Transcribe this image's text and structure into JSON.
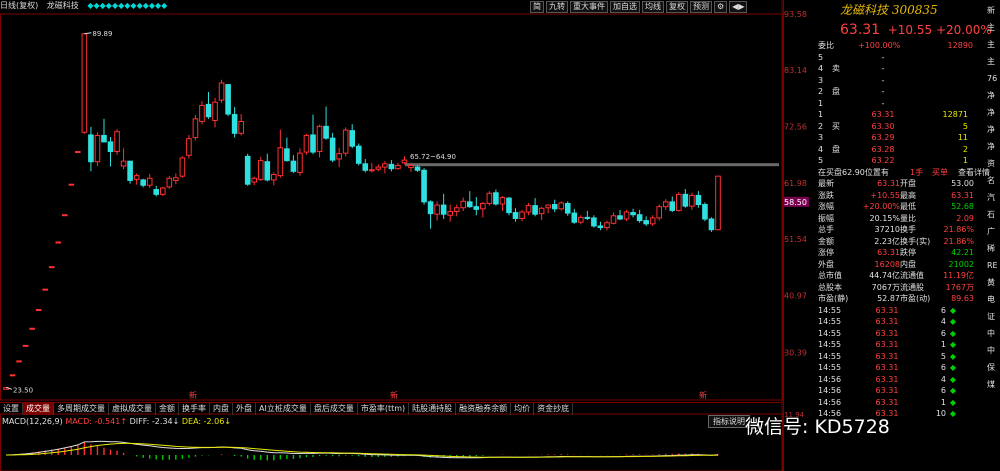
{
  "window": {
    "title": "日线(复权)",
    "stock_name": "龙磁科技"
  },
  "toolbar": [
    "简",
    "九转",
    "重大事件",
    "加自选",
    "均线",
    "复权",
    "预测",
    "⚙",
    "◀▶"
  ],
  "chart_data": {
    "type": "candlestick",
    "y_ticks": [
      93.58,
      83.14,
      72.56,
      61.98,
      51.54,
      40.97,
      30.39
    ],
    "current_price_tag": 58.5,
    "annotations": {
      "high": "89.89",
      "low": "23.50",
      "range": "65.72~64.90"
    },
    "candles": [
      [
        23.5,
        23.8,
        23.5,
        23.8
      ],
      [
        26.2,
        26.2,
        26.2,
        26.2
      ],
      [
        28.8,
        28.8,
        28.8,
        28.8
      ],
      [
        31.7,
        31.7,
        31.7,
        31.7
      ],
      [
        34.9,
        34.9,
        34.9,
        34.9
      ],
      [
        38.4,
        38.4,
        38.4,
        38.4
      ],
      [
        42.2,
        42.2,
        42.2,
        42.2
      ],
      [
        46.4,
        46.4,
        46.4,
        46.4
      ],
      [
        51.0,
        51.0,
        51.0,
        51.0
      ],
      [
        56.1,
        56.1,
        56.1,
        56.1
      ],
      [
        61.8,
        61.8,
        61.8,
        61.8
      ],
      [
        67.9,
        67.9,
        67.9,
        67.9
      ],
      [
        71.5,
        89.9,
        71.2,
        89.9
      ],
      [
        71.0,
        72.5,
        64.2,
        66.0
      ],
      [
        66.0,
        71.5,
        65.2,
        70.9
      ],
      [
        70.9,
        74.0,
        69.6,
        69.7
      ],
      [
        69.7,
        70.6,
        65.1,
        67.9
      ],
      [
        67.9,
        72.1,
        67.3,
        71.6
      ],
      [
        65.2,
        68.5,
        64.6,
        66.1
      ],
      [
        66.1,
        66.1,
        61.9,
        62.5
      ],
      [
        62.7,
        63.8,
        61.7,
        63.4
      ],
      [
        62.6,
        62.8,
        61.2,
        61.6
      ],
      [
        61.6,
        63.7,
        61.1,
        62.9
      ],
      [
        60.8,
        61.5,
        59.5,
        59.9
      ],
      [
        59.9,
        61.3,
        59.6,
        61.1
      ],
      [
        61.3,
        63.3,
        60.9,
        62.9
      ],
      [
        62.5,
        63.8,
        61.8,
        63.0
      ],
      [
        63.3,
        67.0,
        63.0,
        66.7
      ],
      [
        67.2,
        71.0,
        66.6,
        70.3
      ],
      [
        70.5,
        74.7,
        70.0,
        74.0
      ],
      [
        73.5,
        77.3,
        73.0,
        76.5
      ],
      [
        76.7,
        79.0,
        74.0,
        74.4
      ],
      [
        73.7,
        77.9,
        72.4,
        77.1
      ],
      [
        77.5,
        81.3,
        77.0,
        80.7
      ],
      [
        80.4,
        80.5,
        74.5,
        74.9
      ],
      [
        74.8,
        76.2,
        70.5,
        71.3
      ],
      [
        71.3,
        74.9,
        70.9,
        73.5
      ],
      [
        67.0,
        67.5,
        61.5,
        61.8
      ],
      [
        62.2,
        63.2,
        61.6,
        62.9
      ],
      [
        62.7,
        66.9,
        62.4,
        66.2
      ],
      [
        66.0,
        67.5,
        62.3,
        62.6
      ],
      [
        62.6,
        64.0,
        61.6,
        63.6
      ],
      [
        63.4,
        72.0,
        63.0,
        68.6
      ],
      [
        68.4,
        70.5,
        66.0,
        66.2
      ],
      [
        66.1,
        67.2,
        63.9,
        64.2
      ],
      [
        64.0,
        68.5,
        63.4,
        67.6
      ],
      [
        67.8,
        71.2,
        67.3,
        70.9
      ],
      [
        71.0,
        74.8,
        67.4,
        67.8
      ],
      [
        67.9,
        72.9,
        66.8,
        72.6
      ],
      [
        72.6,
        76.3,
        70.1,
        70.4
      ],
      [
        70.4,
        71.4,
        65.9,
        66.3
      ],
      [
        66.5,
        68.6,
        65.0,
        67.5
      ],
      [
        67.6,
        72.4,
        67.0,
        71.9
      ],
      [
        71.8,
        73.0,
        68.5,
        68.9
      ],
      [
        68.9,
        69.4,
        65.3,
        65.7
      ],
      [
        65.6,
        66.5,
        64.0,
        64.4
      ],
      [
        64.5,
        65.8,
        64.0,
        64.5
      ],
      [
        64.6,
        65.5,
        64.2,
        65.0
      ],
      [
        65.0,
        66.1,
        63.8,
        65.6
      ],
      [
        65.5,
        66.3,
        64.2,
        64.7
      ],
      [
        64.7,
        65.8,
        64.5,
        65.3
      ],
      [
        65.8,
        67.0,
        65.5,
        66.3
      ],
      [
        64.9,
        65.7,
        64.1,
        65.3
      ],
      [
        65.0,
        65.3,
        64.1,
        64.4
      ],
      [
        64.4,
        64.8,
        58.0,
        58.5
      ],
      [
        58.5,
        58.8,
        53.5,
        56.3
      ],
      [
        56.2,
        58.6,
        55.0,
        57.9
      ],
      [
        57.9,
        60.0,
        55.3,
        56.2
      ],
      [
        56.0,
        58.0,
        54.8,
        56.7
      ],
      [
        56.7,
        58.0,
        55.8,
        57.4
      ],
      [
        57.4,
        59.3,
        56.8,
        58.6
      ],
      [
        58.5,
        60.5,
        57.4,
        57.6
      ],
      [
        57.6,
        59.4,
        56.0,
        57.1
      ],
      [
        57.2,
        58.5,
        55.6,
        58.2
      ],
      [
        58.2,
        60.5,
        57.8,
        60.1
      ],
      [
        60.2,
        60.8,
        57.8,
        58.1
      ],
      [
        58.1,
        59.6,
        56.8,
        59.3
      ],
      [
        59.2,
        59.4,
        56.0,
        56.5
      ],
      [
        56.5,
        57.3,
        54.8,
        55.4
      ],
      [
        55.4,
        57.0,
        54.9,
        56.6
      ],
      [
        56.6,
        58.3,
        56.0,
        57.8
      ],
      [
        57.8,
        59.2,
        55.8,
        56.2
      ],
      [
        56.3,
        57.6,
        55.1,
        57.3
      ],
      [
        57.4,
        58.0,
        56.4,
        57.9
      ],
      [
        58.0,
        58.9,
        56.6,
        57.2
      ],
      [
        57.2,
        58.6,
        56.9,
        58.3
      ],
      [
        58.2,
        58.6,
        55.9,
        56.4
      ],
      [
        56.4,
        57.2,
        54.4,
        54.7
      ],
      [
        54.7,
        56.0,
        54.3,
        55.6
      ],
      [
        55.6,
        56.8,
        55.1,
        55.4
      ],
      [
        55.5,
        56.0,
        53.7,
        54.0
      ],
      [
        54.0,
        54.8,
        53.2,
        53.7
      ],
      [
        53.7,
        55.0,
        53.2,
        54.6
      ],
      [
        54.5,
        56.5,
        54.3,
        55.9
      ],
      [
        55.9,
        57.0,
        55.1,
        55.3
      ],
      [
        55.3,
        57.0,
        54.9,
        56.6
      ],
      [
        56.5,
        57.2,
        55.6,
        56.1
      ],
      [
        56.1,
        57.0,
        54.6,
        55.0
      ],
      [
        55.0,
        55.8,
        54.0,
        54.4
      ],
      [
        54.4,
        56.0,
        54.0,
        55.5
      ],
      [
        55.5,
        58.0,
        55.0,
        57.6
      ],
      [
        57.6,
        59.0,
        57.0,
        58.5
      ],
      [
        58.5,
        59.5,
        56.6,
        56.9
      ],
      [
        56.9,
        60.3,
        56.7,
        59.9
      ],
      [
        59.9,
        60.9,
        57.4,
        57.7
      ],
      [
        57.7,
        60.2,
        57.0,
        59.7
      ],
      [
        59.7,
        60.5,
        57.4,
        58.0
      ],
      [
        58.0,
        58.4,
        54.9,
        55.3
      ],
      [
        55.3,
        55.6,
        52.9,
        53.3
      ],
      [
        53.3,
        63.3,
        53.3,
        63.3
      ]
    ],
    "macd": {
      "label": "MACD(12,26,9)",
      "macd": "MACD: -0.541↑",
      "diff": "DIFF: -2.34↓",
      "dea": "DEA: -2.06↓",
      "axis_top": "11.94"
    }
  },
  "markers": {
    "a": "新",
    "b": "新",
    "c": "新",
    "d": "新"
  },
  "tabs": [
    "设置",
    "成交量",
    "多周期成交量",
    "虚拟成交量",
    "金额",
    "换手率",
    "内盘",
    "外盘",
    "AI立桩成交量",
    "盘后成交量",
    "市盈率(ttm)",
    "陆股通持股",
    "融资融券余额",
    "均价",
    "资金抄底"
  ],
  "active_tab": "成交量",
  "index_button": "指标说明",
  "quote": {
    "name": "龙磁科技",
    "code": "300835",
    "price": "63.31",
    "change": "+10.55",
    "pct": "+20.00%",
    "weibi_label": "委比",
    "weibi": "+100.00%",
    "weicha": "12890",
    "sell_label": "卖盘",
    "buy_label": "买盘",
    "asks": [
      [
        "5",
        "-",
        ""
      ],
      [
        "4",
        "-",
        ""
      ],
      [
        "3",
        "-",
        ""
      ],
      [
        "2",
        "-",
        ""
      ],
      [
        "1",
        "-",
        ""
      ]
    ],
    "bids": [
      [
        "1",
        "63.31",
        "12871"
      ],
      [
        "2",
        "63.30",
        "5"
      ],
      [
        "3",
        "63.29",
        "11"
      ],
      [
        "4",
        "63.28",
        "2"
      ],
      [
        "5",
        "63.22",
        "1"
      ]
    ],
    "order_note": "在买盘62.90位置有",
    "order_note2": "1手",
    "order_btn": "买单",
    "order_detail": "查看详情",
    "stats": [
      [
        "最新",
        "63.31",
        "开盘",
        "53.00"
      ],
      [
        "涨跌",
        "+10.55",
        "最高",
        "63.31"
      ],
      [
        "涨幅",
        "+20.00%",
        "最低",
        "52.68"
      ],
      [
        "振幅",
        "20.15%",
        "量比",
        "2.09"
      ],
      [
        "总手",
        "37210",
        "换手",
        "21.86%"
      ],
      [
        "金额",
        "2.23亿",
        "换手(实)",
        "21.86%"
      ],
      [
        "涨停",
        "63.31",
        "跌停",
        "42.21"
      ],
      [
        "外盘",
        "16208",
        "内盘",
        "21002"
      ],
      [
        "总市值",
        "44.74亿",
        "流通值",
        "11.19亿"
      ],
      [
        "总股本",
        "7067万",
        "流通股",
        "1767万"
      ],
      [
        "市盈(静)",
        "52.87",
        "市盈(动)",
        "89.63"
      ]
    ],
    "ticks": [
      [
        "14:55",
        "63.31",
        "6"
      ],
      [
        "14:55",
        "63.31",
        "4"
      ],
      [
        "14:55",
        "63.31",
        "6"
      ],
      [
        "14:55",
        "63.31",
        "1"
      ],
      [
        "14:55",
        "63.31",
        "5"
      ],
      [
        "14:55",
        "63.31",
        "6"
      ],
      [
        "14:56",
        "63.31",
        "4"
      ],
      [
        "14:56",
        "63.31",
        "6"
      ],
      [
        "14:56",
        "63.31",
        "1"
      ],
      [
        "14:56",
        "63.31",
        "10"
      ]
    ],
    "side_labels": [
      "新",
      "主",
      "主",
      "主",
      "76",
      "净",
      "净",
      "净",
      "净",
      "资",
      "名",
      "汽",
      "石",
      "广",
      "稀",
      "RE",
      "黄",
      "电",
      "证",
      "中",
      "中",
      "保",
      "煤"
    ]
  },
  "watermark": "微信号: KD5728"
}
